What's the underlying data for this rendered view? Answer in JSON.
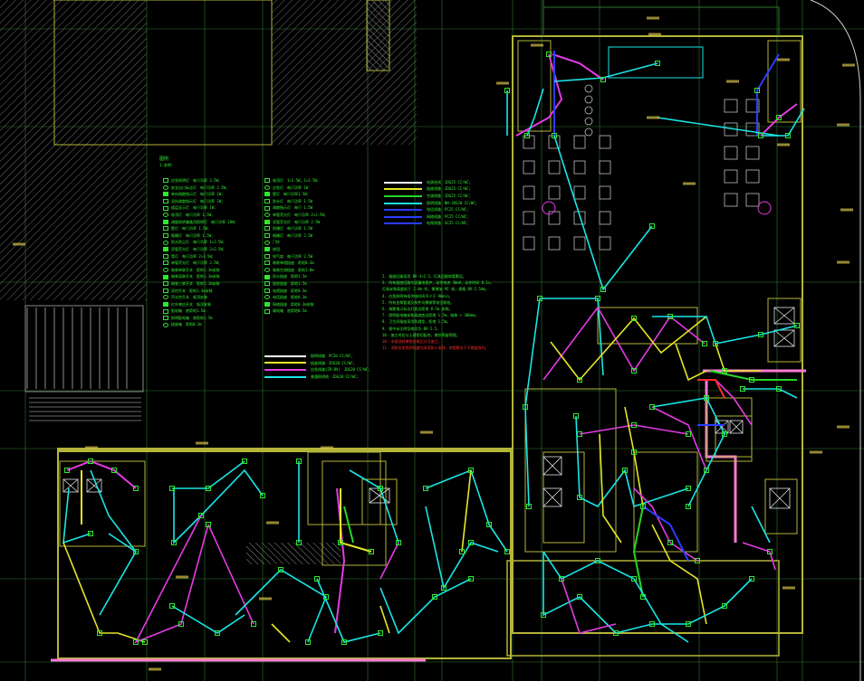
{
  "drawing": {
    "background": "#000000",
    "colors": {
      "wall": "#b4b43a",
      "grid": "#2f7a2f",
      "cyan_wire": "#19e6e6",
      "magenta_wire": "#e33be3",
      "yellow_wire": "#e6e627",
      "green_wire": "#27d627",
      "blue_wire": "#2a3cff",
      "red_wire": "#ff2a2a",
      "pink_wall": "#ff7ad6",
      "device_green": "#2ee82e",
      "text_green": "#33f033",
      "text_red": "#ff3030",
      "hatch": "#6f6f6f"
    },
    "legend_title": "图例",
    "legend_subtitle": "1.说明：",
    "legend_col1": [
      {
        "label": "应急照明灯",
        "spec": "每只功率 2.5W；"
      },
      {
        "label": "安全出口标志灯",
        "spec": "每只功率 2.5W；"
      },
      {
        "label": "单向疏散指示灯",
        "spec": "每只功率 1W；"
      },
      {
        "label": "双向疏散指示灯",
        "spec": "每只功率 1W；"
      },
      {
        "label": "楼层显示灯",
        "spec": "每只功率 1W；"
      },
      {
        "label": "吸顶灯",
        "spec": "每只功率 1.5W；"
      },
      {
        "label": "疏散照明兼备用照明灯",
        "spec": "每只功率 18W；"
      },
      {
        "label": "壁灯",
        "spec": "每只功率 1.5W；"
      },
      {
        "label": "格栅灯",
        "spec": "每只功率 1.5W；"
      },
      {
        "label": "防水防尘灯",
        "spec": "每只功率 1×2.5W；"
      },
      {
        "label": "双管荧光灯",
        "spec": "每只功率 2×2.5W；"
      },
      {
        "label": "筒灯",
        "spec": "每只功率 2×2.5W；"
      },
      {
        "label": "单管荧光灯",
        "spec": "每只功率 2.5W；"
      },
      {
        "label": "暗装单联开关",
        "spec": "距地1.3m安装"
      },
      {
        "label": "暗装双联开关",
        "spec": "距地1.3m安装"
      },
      {
        "label": "暗装三联开关",
        "spec": "距地1.3m安装"
      },
      {
        "label": "双控开关",
        "spec": "距地1.3m安装"
      },
      {
        "label": "声光控开关",
        "spec": "吸顶安装"
      },
      {
        "label": "红外感应开关",
        "spec": "吸顶安装"
      },
      {
        "label": "配电箱",
        "spec": "底距地1.5m"
      },
      {
        "label": "照明配电箱",
        "spec": "底距地1.5m"
      },
      {
        "label": "插座箱",
        "spec": "距地0.3m"
      }
    ],
    "legend_col2": [
      {
        "label": "吸顶灯",
        "spec": "1×2.5W，1×2.5W；"
      },
      {
        "label": "应急灯",
        "spec": "每只功率 1W"
      },
      {
        "label": "壁灯",
        "spec": "每只功率1.5W；"
      },
      {
        "label": "防水灯",
        "spec": "每只功率 1.5W"
      },
      {
        "label": "疏散指示灯",
        "spec": "每只 1.5W"
      },
      {
        "label": "单管荧光灯",
        "spec": "每只功率 2×2.5W；"
      },
      {
        "label": "双管荧光灯",
        "spec": "每只功率 2.5W"
      },
      {
        "label": "防爆灯",
        "spec": "每只功率 1.5W"
      },
      {
        "label": "格栅灯",
        "spec": "每只功率 2.5W"
      },
      {
        "label": "门铃",
        "spec": ""
      },
      {
        "label": "按钮",
        "spec": ""
      },
      {
        "label": "排气扇",
        "spec": "每只功率 2.5W"
      },
      {
        "label": "暗装单相插座",
        "spec": "距地0.3m"
      },
      {
        "label": "暗装空调插座",
        "spec": "距地1.8m"
      },
      {
        "label": "防水插座",
        "spec": "距地1.5m"
      },
      {
        "label": "厨房插座",
        "spec": "距地1.5m"
      },
      {
        "label": "电视插座",
        "spec": "距地0.3m"
      },
      {
        "label": "电话插座",
        "spec": "距地0.3m"
      },
      {
        "label": "网络插座",
        "spec": "距地0.3m安装"
      },
      {
        "label": "弱电箱",
        "spec": "底距地0.5m"
      }
    ],
    "wire_legend_mid": [
      {
        "color": "#ffffff",
        "label": "照明线路",
        "spec": "PC20 CC/WC；"
      },
      {
        "color": "#e6e627",
        "label": "插座线路",
        "spec": "JDG20 CC/WC；"
      },
      {
        "color": "#e33be3",
        "label": "应急线路(ZR-BV)",
        "spec": "JDG20 CC/WC；"
      },
      {
        "color": "#19e6e6",
        "label": "普通照明线",
        "spec": "JDG20 CC/WC；"
      }
    ],
    "wire_legend_right": [
      {
        "color": "#ffffff",
        "label": "电源进线",
        "spec": "JDG25 CC/WC；"
      },
      {
        "color": "#e6e627",
        "label": "插座线路",
        "spec": "JDG25 CC/WC；"
      },
      {
        "color": "#27d627",
        "label": "空调线路",
        "spec": "JDG25 CC/WC；"
      },
      {
        "color": "#19e6e6",
        "label": "照明线路",
        "spec": "NH-JDG20 CC/WC；"
      },
      {
        "color": "#2a3cff",
        "label": "电话线路",
        "spec": "PC25 CC/WC；"
      },
      {
        "color": "#2a3cff",
        "label": "网络线路",
        "spec": "PC25 CC/WC；"
      },
      {
        "color": "#2a3cff",
        "label": "电视线路",
        "spec": "SC25 CC/WC；"
      }
    ],
    "notes": [
      {
        "text": "2. 插座回路采用 BV-3×2.5，灯具回路穿管敷设。",
        "red": false
      },
      {
        "text": "3. 所有插座回路均设漏电保护，动作电流 30mA，动作时间 0.1s。",
        "red": false
      },
      {
        "text": "   灯具安装高度低于 2.4m 时，需增加 PE 线，规格 BV-2.5mm。",
        "red": false
      },
      {
        "text": "4. 应急照明持续供电时间不少于 90min。",
        "red": false
      },
      {
        "text": "5. 所有金属管道及构件均需做等电位联结。",
        "red": false
      },
      {
        "text": "6. 疏散指示标志灯底边距地 0.5m 安装。",
        "red": false
      },
      {
        "text": "7. 照明配电箱安装高度底边距地 1.5m，暗装 > 300mm。",
        "red": false
      },
      {
        "text": "8. 卫生间插座采用防溅型，距地 1.5m。",
        "red": false
      },
      {
        "text": "9. 图中未注明导线均为 BV-2.5。",
        "red": false
      },
      {
        "text": "10. 施工时应与土建密切配合，做好预留预埋。",
        "red": false
      },
      {
        "text": "10. 本图须经审图合格后方可施工。",
        "red": true
      },
      {
        "text": "11. 消防应急照明线路均采用耐火电线，穿管敷设于不燃烧体内。",
        "red": true
      }
    ]
  }
}
